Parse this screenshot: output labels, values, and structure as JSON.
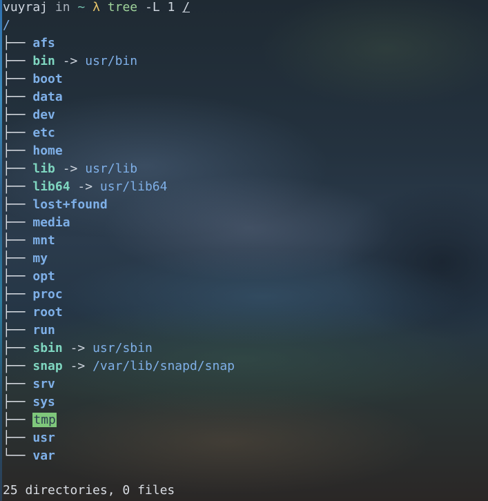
{
  "prompt": {
    "user": "vuyraj",
    "in": "in",
    "tilde": "~",
    "lambda": "λ",
    "command": "tree",
    "args": "-L 1",
    "path": "/"
  },
  "tree": {
    "root": "/",
    "branch": "├──",
    "last_branch": "└──",
    "arrow": "->",
    "entries": [
      {
        "name": "afs"
      },
      {
        "name": "bin",
        "target": "usr/bin"
      },
      {
        "name": "boot"
      },
      {
        "name": "data"
      },
      {
        "name": "dev"
      },
      {
        "name": "etc"
      },
      {
        "name": "home"
      },
      {
        "name": "lib",
        "target": "usr/lib"
      },
      {
        "name": "lib64",
        "target": "usr/lib64"
      },
      {
        "name": "lost+found"
      },
      {
        "name": "media"
      },
      {
        "name": "mnt"
      },
      {
        "name": "my"
      },
      {
        "name": "opt"
      },
      {
        "name": "proc"
      },
      {
        "name": "root"
      },
      {
        "name": "run"
      },
      {
        "name": "sbin",
        "target": "usr/sbin"
      },
      {
        "name": "snap",
        "target": "/var/lib/snapd/snap"
      },
      {
        "name": "srv"
      },
      {
        "name": "sys"
      },
      {
        "name": "tmp",
        "highlight": true
      },
      {
        "name": "usr"
      },
      {
        "name": "var"
      }
    ]
  },
  "summary": "25 directories, 0 files",
  "colors": {
    "directory": "#7fb0e8",
    "symlink": "#7fd6c0",
    "sticky_highlight": "#7fc77b"
  }
}
